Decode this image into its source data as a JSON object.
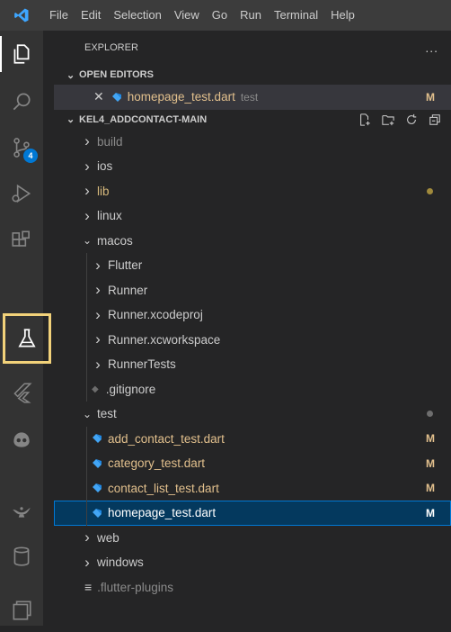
{
  "menubar": {
    "items": [
      "File",
      "Edit",
      "Selection",
      "View",
      "Go",
      "Run",
      "Terminal",
      "Help"
    ]
  },
  "activity": {
    "source_control_badge": "4"
  },
  "explorer": {
    "title": "EXPLORER",
    "more": "...",
    "open_editors": {
      "header": "OPEN EDITORS",
      "items": [
        {
          "name": "homepage_test.dart",
          "folder": "test",
          "status": "M"
        }
      ]
    },
    "project": {
      "header": "KEL4_ADDCONTACT-MAIN",
      "rows": [
        {
          "label": "build",
          "type": "folder",
          "expanded": false,
          "depth": 0,
          "muted": true
        },
        {
          "label": "ios",
          "type": "folder",
          "expanded": false,
          "depth": 0
        },
        {
          "label": "lib",
          "type": "folder",
          "expanded": false,
          "depth": 0,
          "modified": true
        },
        {
          "label": "linux",
          "type": "folder",
          "expanded": false,
          "depth": 0
        },
        {
          "label": "macos",
          "type": "folder",
          "expanded": true,
          "depth": 0
        },
        {
          "label": "Flutter",
          "type": "folder",
          "expanded": false,
          "depth": 1
        },
        {
          "label": "Runner",
          "type": "folder",
          "expanded": false,
          "depth": 1
        },
        {
          "label": "Runner.xcodeproj",
          "type": "folder",
          "expanded": false,
          "depth": 1
        },
        {
          "label": "Runner.xcworkspace",
          "type": "folder",
          "expanded": false,
          "depth": 1
        },
        {
          "label": "RunnerTests",
          "type": "folder",
          "expanded": false,
          "depth": 1
        },
        {
          "label": ".gitignore",
          "type": "file",
          "depth": 1
        },
        {
          "label": "test",
          "type": "folder",
          "expanded": true,
          "depth": 0
        },
        {
          "label": "add_contact_test.dart",
          "type": "dart",
          "depth": 1,
          "status": "M"
        },
        {
          "label": "category_test.dart",
          "type": "dart",
          "depth": 1,
          "status": "M"
        },
        {
          "label": "contact_list_test.dart",
          "type": "dart",
          "depth": 1,
          "status": "M"
        },
        {
          "label": "homepage_test.dart",
          "type": "dart",
          "depth": 1,
          "status": "M",
          "selected": true
        },
        {
          "label": "web",
          "type": "folder",
          "expanded": false,
          "depth": 0
        },
        {
          "label": "windows",
          "type": "folder",
          "expanded": false,
          "depth": 0
        },
        {
          "label": ".flutter-plugins",
          "type": "lines",
          "depth": 0,
          "muted": true
        }
      ]
    }
  },
  "colors": {
    "modified": "#e2c08d",
    "lib_folder": "#d7ba7d",
    "dart_blue": "#42a5f5",
    "muted": "#8b8b8b",
    "highlight": "#f2d27a"
  }
}
